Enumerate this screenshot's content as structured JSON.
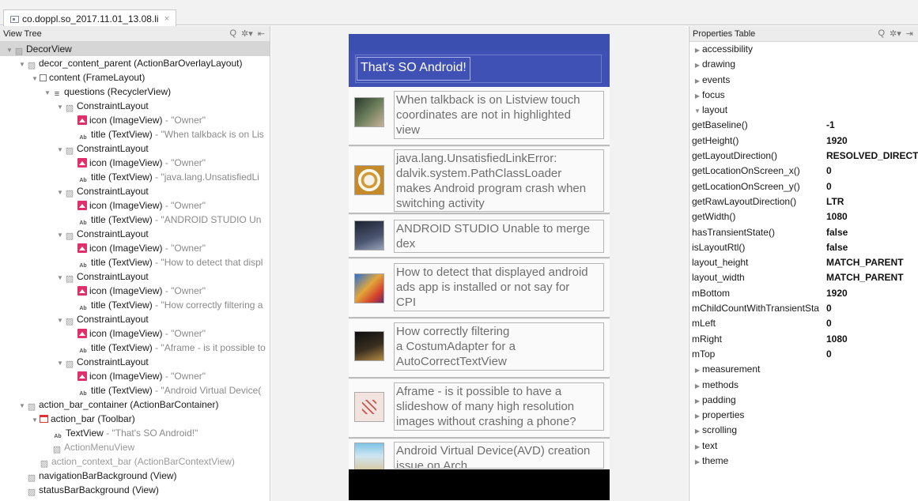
{
  "tab": {
    "title": "co.doppl.so_2017.11.01_13.08.li",
    "close": "×",
    "icon": "device-capture-icon"
  },
  "view_tree": {
    "header": "View Tree",
    "tools": [
      "Q",
      "✲▾",
      "⇤"
    ],
    "rows": [
      {
        "name": "DecorView",
        "desc": "",
        "icon": "hatch",
        "selected": true
      },
      {
        "name": "decor_content_parent (ActionBarOverlayLayout)",
        "desc": "",
        "icon": "hatch"
      },
      {
        "name": "content (FrameLayout)",
        "desc": "",
        "icon": "frame"
      },
      {
        "name": "questions (RecyclerView)",
        "desc": "",
        "icon": "list"
      },
      {
        "name": "ConstraintLayout",
        "desc": "",
        "icon": "hatch"
      },
      {
        "name": "icon (ImageView)",
        "desc": " - \"Owner\"",
        "icon": "image"
      },
      {
        "name": "title (TextView)",
        "desc": " - \"When talkback is on Lis",
        "icon": "text"
      },
      {
        "name": "ConstraintLayout",
        "desc": "",
        "icon": "hatch"
      },
      {
        "name": "icon (ImageView)",
        "desc": " - \"Owner\"",
        "icon": "image"
      },
      {
        "name": "title (TextView)",
        "desc": " - \"java.lang.UnsatisfiedLi",
        "icon": "text"
      },
      {
        "name": "ConstraintLayout",
        "desc": "",
        "icon": "hatch"
      },
      {
        "name": "icon (ImageView)",
        "desc": " - \"Owner\"",
        "icon": "image"
      },
      {
        "name": "title (TextView)",
        "desc": " - \"ANDROID STUDIO Un",
        "icon": "text"
      },
      {
        "name": "ConstraintLayout",
        "desc": "",
        "icon": "hatch"
      },
      {
        "name": "icon (ImageView)",
        "desc": " - \"Owner\"",
        "icon": "image"
      },
      {
        "name": "title (TextView)",
        "desc": " - \"How to detect that displ",
        "icon": "text"
      },
      {
        "name": "ConstraintLayout",
        "desc": "",
        "icon": "hatch"
      },
      {
        "name": "icon (ImageView)",
        "desc": " - \"Owner\"",
        "icon": "image"
      },
      {
        "name": "title (TextView)",
        "desc": " - \"How correctly filtering a",
        "icon": "text"
      },
      {
        "name": "ConstraintLayout",
        "desc": "",
        "icon": "hatch"
      },
      {
        "name": "icon (ImageView)",
        "desc": " - \"Owner\"",
        "icon": "image"
      },
      {
        "name": "title (TextView)",
        "desc": " - \"Aframe - is it possible to",
        "icon": "text"
      },
      {
        "name": "ConstraintLayout",
        "desc": "",
        "icon": "hatch"
      },
      {
        "name": "icon (ImageView)",
        "desc": " - \"Owner\"",
        "icon": "image"
      },
      {
        "name": "title (TextView)",
        "desc": " - \"Android Virtual Device(",
        "icon": "text"
      },
      {
        "name": "action_bar_container (ActionBarContainer)",
        "desc": "",
        "icon": "hatch"
      },
      {
        "name": "action_bar (Toolbar)",
        "desc": "",
        "icon": "toolbar"
      },
      {
        "name": "TextView",
        "desc": " - \"That's SO Android!\"",
        "icon": "text"
      },
      {
        "name": "ActionMenuView",
        "desc": "",
        "icon": "hatch",
        "dim": true
      },
      {
        "name": "action_context_bar (ActionBarContextView)",
        "desc": "",
        "icon": "hatch",
        "dim": true
      },
      {
        "name": "navigationBarBackground (View)",
        "desc": "",
        "icon": "hatch"
      },
      {
        "name": "statusBarBackground (View)",
        "desc": "",
        "icon": "hatch"
      }
    ]
  },
  "device": {
    "title": "That's SO Android!",
    "items": [
      {
        "text": "When talkback is on Listview touch\ncoordinates are not in highlighted\nview",
        "thumb": "person-avatar"
      },
      {
        "text": "java.lang.UnsatisfiedLinkError:\ndalvik.system.PathClassLoader\nmakes Android program crash when\nswitching activity",
        "thumb": "pattern-avatar"
      },
      {
        "text": "ANDROID STUDIO Unable to merge\ndex",
        "thumb": "dj-avatar"
      },
      {
        "text": "How to detect that displayed android\nads app is installed or not say for\nCPI",
        "thumb": "lion-avatar"
      },
      {
        "text": "How correctly filtering\na CostumAdapter for a\nAutoCorrectTextView",
        "thumb": "dark-avatar"
      },
      {
        "text": "Aframe - is it possible to have a\nslideshow of many high resolution\nimages without crashing a phone?",
        "thumb": "quilt-avatar"
      },
      {
        "text": "Android Virtual Device(AVD) creation\nissue on Arch",
        "thumb": "beach-avatar"
      }
    ]
  },
  "properties": {
    "header": "Properties Table",
    "tools": [
      "Q",
      "✲▾",
      "⇥"
    ],
    "groups_top": [
      "accessibility",
      "drawing",
      "events",
      "focus"
    ],
    "open_group": "layout",
    "layout_props": [
      {
        "key": "getBaseline()",
        "value": "-1"
      },
      {
        "key": "getHeight()",
        "value": "1920"
      },
      {
        "key": "getLayoutDirection()",
        "value": "RESOLVED_DIRECT"
      },
      {
        "key": "getLocationOnScreen_x()",
        "value": "0"
      },
      {
        "key": "getLocationOnScreen_y()",
        "value": "0"
      },
      {
        "key": "getRawLayoutDirection()",
        "value": "LTR"
      },
      {
        "key": "getWidth()",
        "value": "1080"
      },
      {
        "key": "hasTransientState()",
        "value": "false"
      },
      {
        "key": "isLayoutRtl()",
        "value": "false"
      },
      {
        "key": "layout_height",
        "value": "MATCH_PARENT"
      },
      {
        "key": "layout_width",
        "value": "MATCH_PARENT"
      },
      {
        "key": "mBottom",
        "value": "1920"
      },
      {
        "key": "mChildCountWithTransientSta",
        "value": "0"
      },
      {
        "key": "mLeft",
        "value": "0"
      },
      {
        "key": "mRight",
        "value": "1080"
      },
      {
        "key": "mTop",
        "value": "0"
      }
    ],
    "groups_bottom": [
      "measurement",
      "methods",
      "padding",
      "properties",
      "scrolling",
      "text",
      "theme"
    ]
  },
  "colors": {
    "action_bar": "#3f51b5",
    "status_bar": "#3a4fb0",
    "image_icon": "#e0306a"
  }
}
